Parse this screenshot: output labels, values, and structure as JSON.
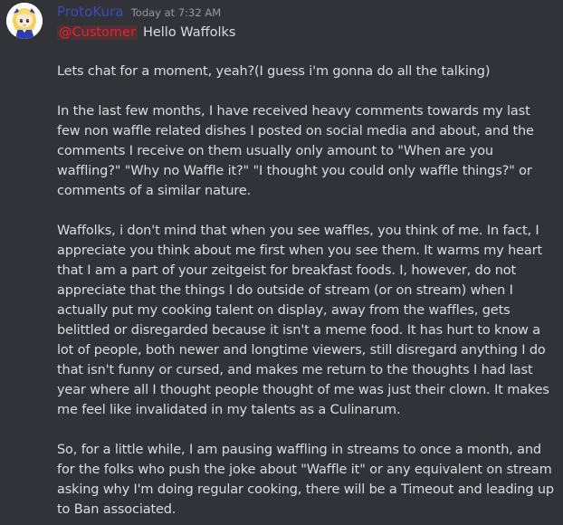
{
  "message": {
    "author": "ProtoKura",
    "timestamp": "Today at 7:32 AM",
    "mention": "@Customer",
    "greeting": "Hello Waffolks",
    "paragraphs": [
      "Lets chat for a moment, yeah?(I guess i'm gonna do all the talking)",
      "In the last few months, I have received heavy comments towards my last few non waffle related dishes I posted on social media and about, and the comments I receive on them usually only amount to \"When are you waffling?\" \"Why no Waffle it?\" \"I thought you could only waffle things?\" or comments of a similar nature.",
      "Waffolks, i don't mind that when you see waffles, you think of me. In fact, I appreciate you think about me first when you see them. It warms my heart that I am a part of your zeitgeist for breakfast foods. I, however, do not appreciate that the things I do outside of stream (or on stream) when I actually put my cooking talent on display, away from the waffles, gets belittled or disregarded because it isn't a meme food. It has hurt to know a lot of people, both newer and longtime viewers, still disregard anything I do that isn't funny or cursed, and makes me return to the thoughts I had last year where all I thought people thought of me was just their clown. It makes me feel like invalidated in my talents as a Culinarum.",
      "So, for a little while, I am pausing waffling in streams to once a month, and for the folks who push the joke about \"Waffle it\" or any equivalent on stream asking why I'm doing regular cooking, there will be a Timeout and leading up to Ban associated."
    ]
  },
  "colors": {
    "background": "#313338",
    "username": "#3e4ab8",
    "mention": "#e0252f",
    "text": "#dbdee1",
    "timestamp": "#949ba4"
  }
}
